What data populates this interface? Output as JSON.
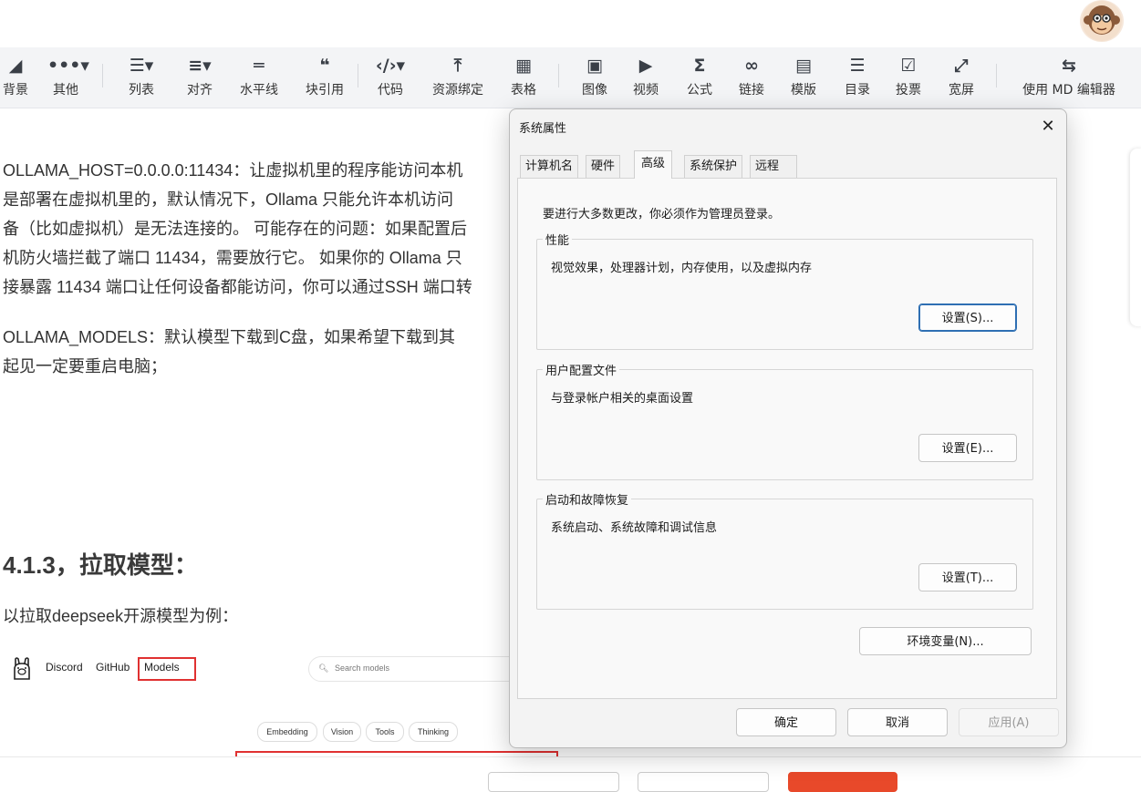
{
  "toolbar": {
    "items": [
      {
        "label": "背景",
        "icon": "paint-bucket-icon"
      },
      {
        "label": "其他",
        "icon": "more-dots-icon"
      },
      {
        "label": "列表",
        "icon": "list-icon"
      },
      {
        "label": "对齐",
        "icon": "align-icon"
      },
      {
        "label": "水平线",
        "icon": "horizontal-rule-icon"
      },
      {
        "label": "块引用",
        "icon": "quote-icon"
      },
      {
        "label": "代码",
        "icon": "code-icon"
      },
      {
        "label": "资源绑定",
        "icon": "upload-icon"
      },
      {
        "label": "表格",
        "icon": "table-icon"
      },
      {
        "label": "图像",
        "icon": "image-icon"
      },
      {
        "label": "视频",
        "icon": "video-icon"
      },
      {
        "label": "公式",
        "icon": "sigma-icon"
      },
      {
        "label": "链接",
        "icon": "link-icon"
      },
      {
        "label": "模版",
        "icon": "template-icon"
      },
      {
        "label": "目录",
        "icon": "toc-icon"
      },
      {
        "label": "投票",
        "icon": "vote-icon"
      },
      {
        "label": "宽屏",
        "icon": "widescreen-icon"
      },
      {
        "label": "使用 MD 编辑器",
        "icon": "switch-editor-icon"
      }
    ]
  },
  "article": {
    "para1": [
      "OLLAMA_HOST=0.0.0.0:11434：让虚拟机里的程序能访问本机",
      "是部署在虚拟机里的，默认情况下，Ollama 只能允许本机访问",
      "备（比如虚拟机）是无法连接的。 可能存在的问题：如果配置后",
      "机防火墙拦截了端口 11434，需要放行它。 如果你的 Ollama 只",
      "接暴露 11434 端口让任何设备都能访问，你可以通过SSH 端口转"
    ],
    "para2": [
      "OLLAMA_MODELS：默认模型下载到C盘，如果希望下载到其",
      "起见一定要重启电脑；"
    ],
    "heading": "4.1.3，拉取模型：",
    "subtext": "以拉取deepseek开源模型为例：",
    "ollama": {
      "nav": [
        "Discord",
        "GitHub",
        "Models"
      ],
      "search_placeholder": "Search models",
      "chips": [
        "Embedding",
        "Vision",
        "Tools",
        "Thinking"
      ]
    }
  },
  "dialog": {
    "title": "系统属性",
    "tabs": [
      "计算机名",
      "硬件",
      "高级",
      "系统保护",
      "远程"
    ],
    "active_tab": "高级",
    "note": "要进行大多数更改，你必须作为管理员登录。",
    "groups": [
      {
        "title": "性能",
        "desc": "视觉效果，处理器计划，内存使用，以及虚拟内存",
        "button": "设置(S)..."
      },
      {
        "title": "用户配置文件",
        "desc": "与登录帐户相关的桌面设置",
        "button": "设置(E)..."
      },
      {
        "title": "启动和故障恢复",
        "desc": "系统启动、系统故障和调试信息",
        "button": "设置(T)..."
      }
    ],
    "env_button": "环境变量(N)...",
    "ok": "确定",
    "cancel": "取消",
    "apply": "应用(A)"
  }
}
